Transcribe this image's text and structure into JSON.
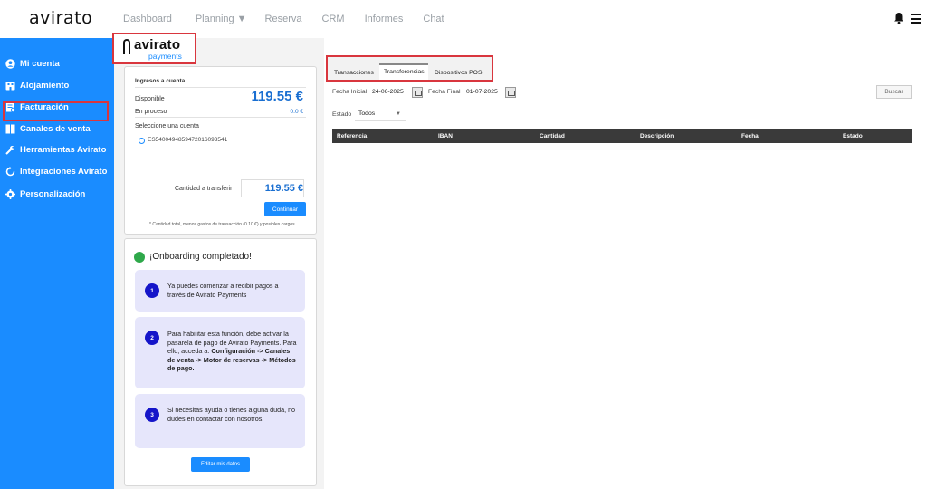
{
  "header": {
    "logo": "avirato",
    "nav": [
      {
        "label": "Dashboard"
      },
      {
        "label": "Planning"
      },
      {
        "label": "Reserva"
      },
      {
        "label": "CRM"
      },
      {
        "label": "Informes"
      },
      {
        "label": "Chat"
      }
    ]
  },
  "sidebar": {
    "items": [
      {
        "label": "Mi cuenta",
        "icon": "user-icon"
      },
      {
        "label": "Alojamiento",
        "icon": "building-icon"
      },
      {
        "label": "Facturación",
        "icon": "invoice-icon"
      },
      {
        "label": "Canales de venta",
        "icon": "grid-icon"
      },
      {
        "label": "Herramientas Avirato",
        "icon": "wrench-icon"
      },
      {
        "label": "Integraciones Avirato",
        "icon": "sync-icon"
      },
      {
        "label": "Personalización",
        "icon": "gear-icon"
      }
    ],
    "accent": "#1a8cff",
    "highlight": "#d9363e"
  },
  "payments_logo": {
    "brand": "avirato",
    "sub": "payments"
  },
  "account": {
    "title": "Ingresos a cuenta",
    "available_label": "Disponible",
    "available_value": "119.55 €",
    "processing_label": "En proceso",
    "processing_value": "0.0 €",
    "select_label": "Seleccione una cuenta",
    "iban": "ES5400494859472016093541",
    "transfer_label": "Cantidad a transferir",
    "transfer_value": "119.55  €",
    "continue_label": "Continuar",
    "footnote": "* Cantidad total, menos gastos de transacción (0.10 €) y posibles cargos"
  },
  "onboarding": {
    "title": "¡Onboarding completado!",
    "steps": [
      {
        "num": "1",
        "text": "Ya puedes comenzar a recibir pagos a través de Avirato Payments"
      },
      {
        "num": "2",
        "text_a": "Para habilitar esta función, debe activar la pasarela de pago de Avirato Payments. Para ello, acceda a: ",
        "text_b": "Configuración -> Canales de venta -> Motor de reservas -> Métodos de pago."
      },
      {
        "num": "3",
        "text": "Si necesitas ayuda o tienes alguna duda, no dudes en contactar con nosotros."
      }
    ],
    "edit_label": "Editar mis datos"
  },
  "tabs": [
    {
      "label": "Transacciones"
    },
    {
      "label": "Transferencias",
      "active": true
    },
    {
      "label": "Dispositivos POS"
    }
  ],
  "filters": {
    "start_label": "Fecha Inicial",
    "start_value": "24-06-2025",
    "end_label": "Fecha Final",
    "end_value": "01-07-2025",
    "search_label": "Buscar",
    "state_label": "Estado",
    "state_value": "Todos"
  },
  "table": {
    "columns": [
      "Referencia",
      "IBAN",
      "Cantidad",
      "Descripción",
      "Fecha",
      "Estado"
    ]
  }
}
